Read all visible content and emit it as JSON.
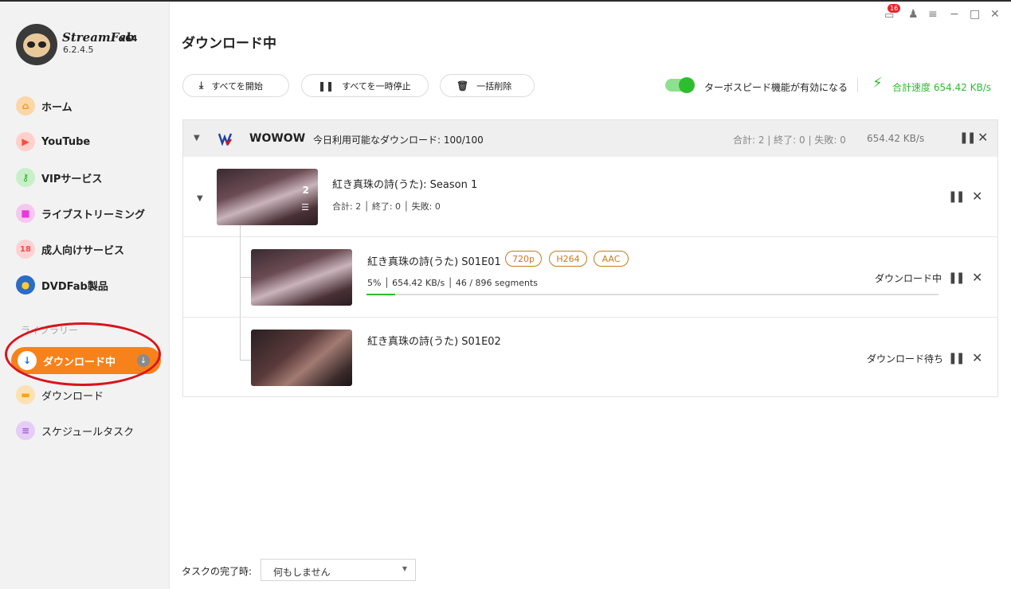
{
  "app": {
    "brand": "StreamFab",
    "arch": "x64",
    "version": "6.2.4.5"
  },
  "window": {
    "notification_count": "16"
  },
  "sidebar": {
    "items": [
      {
        "label": "ホーム",
        "icon": "home-icon",
        "color": "#f7941d"
      },
      {
        "label": "YouTube",
        "icon": "youtube-icon",
        "color": "#ff4a3a"
      },
      {
        "label": "VIPサービス",
        "icon": "key-icon",
        "color": "#3cbf3c"
      },
      {
        "label": "ライブストリーミング",
        "icon": "video-camera-icon",
        "color": "#e83ad9"
      },
      {
        "label": "成人向けサービス",
        "icon": "adult-18-icon",
        "color": "#ef4b4b"
      },
      {
        "label": "DVDFab製品",
        "icon": "dvdfab-icon",
        "color": "#2b6cc4"
      }
    ],
    "library_heading": "ライブラリー",
    "library": [
      {
        "label": "ダウンロード中",
        "icon": "download-arrow-icon",
        "active": true
      },
      {
        "label": "ダウンロード",
        "icon": "folder-icon",
        "color": "#f7a21b"
      },
      {
        "label": "スケジュールタスク",
        "icon": "schedule-list-icon",
        "color": "#a45bd6"
      }
    ]
  },
  "main": {
    "title": "ダウンロード中",
    "toolbar": {
      "start_all": "すべてを開始",
      "pause_all": "すべてを一時停止",
      "delete_all": "一括削除"
    },
    "turbo": {
      "label": "ターボスピード機能が有効になる",
      "enabled": true
    },
    "total_speed": "合計速度 654.42 KB/s",
    "accent_color": "#f7821b",
    "green_color": "#2ebd2e"
  },
  "service": {
    "name": "WOWOW",
    "quota": "今日利用可能なダウンロード: 100/100",
    "stats": "合計: 2 | 終了: 0 | 失敗: 0",
    "speed": "654.42 KB/s"
  },
  "season": {
    "title": "紅き真珠の詩(うた): Season 1",
    "count": "2",
    "stats": "合計: 2 │ 終了: 0 │ 失敗: 0"
  },
  "episodes": [
    {
      "title": "紅き真珠の詩(うた) S01E01",
      "tags": [
        "720p",
        "H264",
        "AAC"
      ],
      "stats": "5% │ 654.42 KB/s │ 46 / 896 segments",
      "progress": 0.05,
      "status": "ダウンロード中"
    },
    {
      "title": "紅き真珠の詩(うた) S01E02",
      "status": "ダウンロード待ち"
    }
  ],
  "footer": {
    "completion_label": "タスクの完了時:",
    "completion_value": "何もしません"
  }
}
